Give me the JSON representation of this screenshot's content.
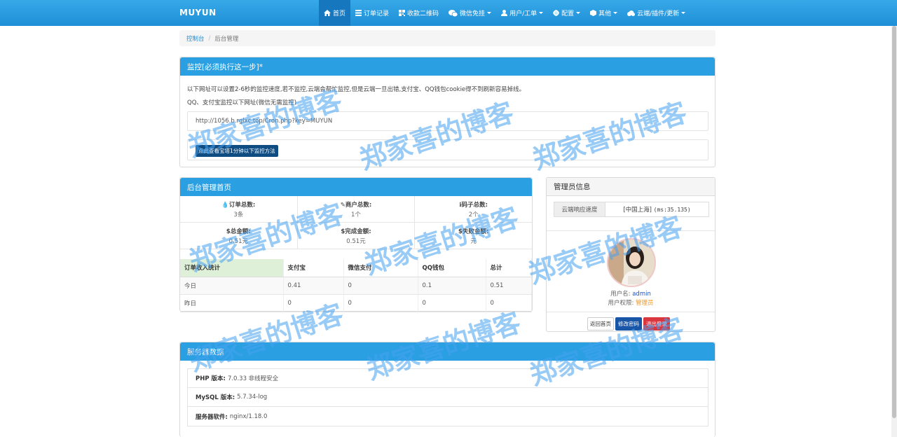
{
  "navbar": {
    "brand": "MUYUN",
    "items": [
      {
        "label": "首页",
        "icon": "home-icon",
        "active": true,
        "dropdown": false
      },
      {
        "label": "订单记录",
        "icon": "list-icon",
        "active": false,
        "dropdown": false
      },
      {
        "label": "收款二维码",
        "icon": "qrcode-icon",
        "active": false,
        "dropdown": false
      },
      {
        "label": "微信免挂",
        "icon": "wechat-icon",
        "active": false,
        "dropdown": true
      },
      {
        "label": "用户/工单",
        "icon": "user-icon",
        "active": false,
        "dropdown": true
      },
      {
        "label": "配置",
        "icon": "gear-icon",
        "active": false,
        "dropdown": true
      },
      {
        "label": "其他",
        "icon": "cube-icon",
        "active": false,
        "dropdown": true
      },
      {
        "label": "云端/插件/更新",
        "icon": "cloud-icon",
        "active": false,
        "dropdown": true
      }
    ]
  },
  "breadcrumb": {
    "home": "控制台",
    "separator": "/",
    "current": "后台管理"
  },
  "monitor": {
    "title": "监控[必须执行这一步]*",
    "line1": "以下网址可以设置2-6秒的监控速度,若不监控,云端会帮忙监控,但是云端一旦出错,支付宝、QQ钱包cookie得不到刷新容易掉线。",
    "line2": "QQ、支付宝监控以下网址(微信无需监控)",
    "url": "http://1056.b.rglxc.top/Cron.php?key=MUYUN",
    "button": "点此查看宝塔1分钟以下监控方法"
  },
  "dashboard": {
    "title": "后台管理首页",
    "stats_row1": [
      {
        "label": "订单总数:",
        "icon": "drop-icon",
        "value": "3条"
      },
      {
        "label": "商户总数:",
        "icon": "edit-icon",
        "value": "1个"
      },
      {
        "label": "码子总数:",
        "icon": "info-icon",
        "value": "2个"
      }
    ],
    "stats_row2": [
      {
        "label": "总金额:",
        "icon": "dollar-icon",
        "value": "0.51元"
      },
      {
        "label": "完成金额:",
        "icon": "dollar-icon",
        "value": "0.51元"
      },
      {
        "label": "失败金额:",
        "icon": "dollar-icon",
        "value": "元"
      }
    ],
    "table": {
      "headers": [
        "订单收入统计",
        "支付宝",
        "微信支付",
        "QQ钱包",
        "总计"
      ],
      "rows": [
        [
          "今日",
          "0.41",
          "0",
          "0.1",
          "0.51"
        ],
        [
          "昨日",
          "0",
          "0",
          "0",
          "0"
        ]
      ]
    }
  },
  "admin": {
    "title": "管理员信息",
    "speed_label": "云端响应速度",
    "speed_location": "[中国上海]",
    "speed_ms": "(ms:35.135)",
    "username_label": "用户名:",
    "username": "admin",
    "role_label": "用户权限:",
    "role": "管理员",
    "buttons": {
      "back": "返回首页",
      "change_pw": "修改密码",
      "logout": "退出登录"
    }
  },
  "server": {
    "title": "服务器数据",
    "items": [
      {
        "label": "PHP 版本:",
        "value": "7.0.33 非线程安全"
      },
      {
        "label": "MySQL 版本:",
        "value": "5.7.34-log"
      },
      {
        "label": "服务器软件:",
        "value": "nginx/1.18.0"
      }
    ]
  },
  "watermark": "郑家喜的博客",
  "colors": {
    "navbar": "#2a9fe2",
    "panel_head": "#2a9fe2",
    "active_nav": "#1677bf",
    "link": "#1e8fd6",
    "watermark": "#46a0f0"
  }
}
